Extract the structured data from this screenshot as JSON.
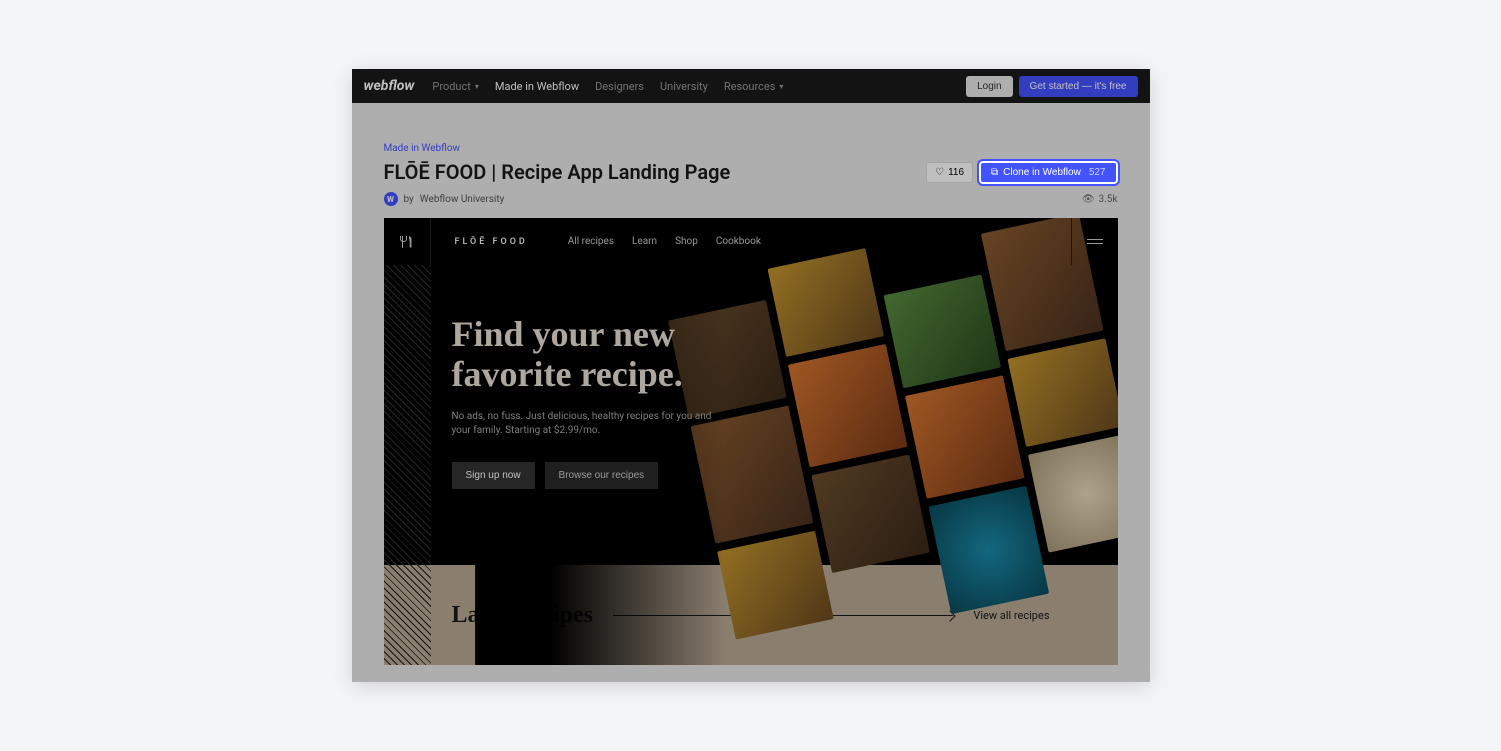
{
  "topnav": {
    "logo": "webflow",
    "items": [
      "Product",
      "Made in Webflow",
      "Designers",
      "University",
      "Resources"
    ],
    "login": "Login",
    "get_started": "Get started — it's free"
  },
  "breadcrumb": "Made in Webflow",
  "page_title": "FLŌĒ FOOD | Recipe App Landing Page",
  "like_count": "116",
  "clone_label": "Clone in Webflow",
  "clone_count": "527",
  "byline_prefix": "by",
  "byline_author": "Webflow University",
  "views": "3.5k",
  "preview": {
    "logo": "FLŌĒ FOOD",
    "nav": [
      "All recipes",
      "Learn",
      "Shop",
      "Cookbook"
    ],
    "hero_title_1": "Find your new",
    "hero_title_2": "favorite recipe.",
    "hero_sub": "No ads, no fuss. Just delicious, healthy recipes for you and your family. Starting at $2.99/mo.",
    "btn_primary": "Sign up now",
    "btn_secondary": "Browse our recipes",
    "latest_title": "Latest recipes",
    "latest_link": "View all recipes"
  }
}
